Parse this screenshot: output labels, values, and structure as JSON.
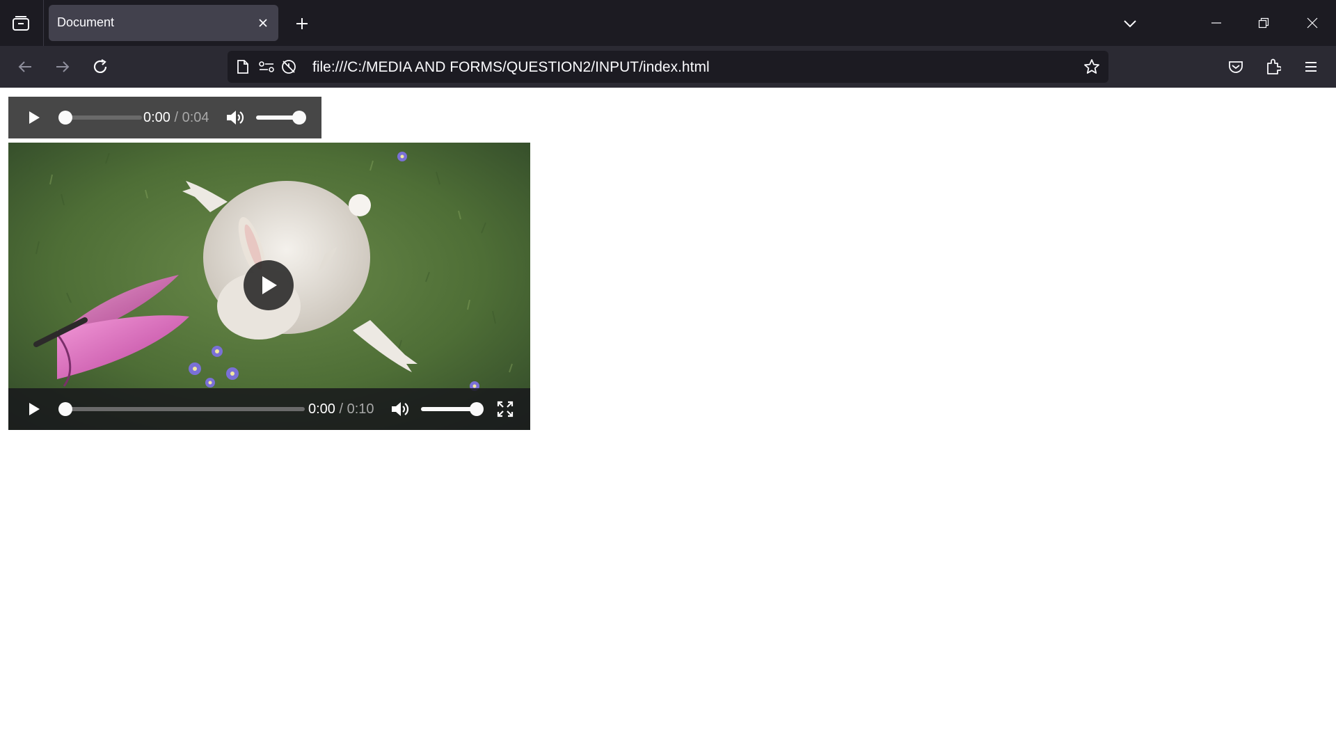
{
  "browser": {
    "tab_title": "Document",
    "url": "file:///C:/MEDIA AND FORMS/QUESTION2/INPUT/index.html"
  },
  "audio": {
    "current_time": "0:00",
    "duration": "/ 0:04",
    "progress": 0,
    "volume": 1.0
  },
  "video": {
    "current_time": "0:00",
    "duration": "/ 0:10",
    "progress": 0,
    "volume": 1.0
  },
  "icons": {
    "play": "play-icon",
    "volume": "volume-icon",
    "fullscreen": "fullscreen-icon"
  },
  "colors": {
    "chrome_dark": "#1c1b22",
    "toolbar": "#2b2a33",
    "active_tab": "#42414d",
    "audio_bg": "#474747"
  }
}
